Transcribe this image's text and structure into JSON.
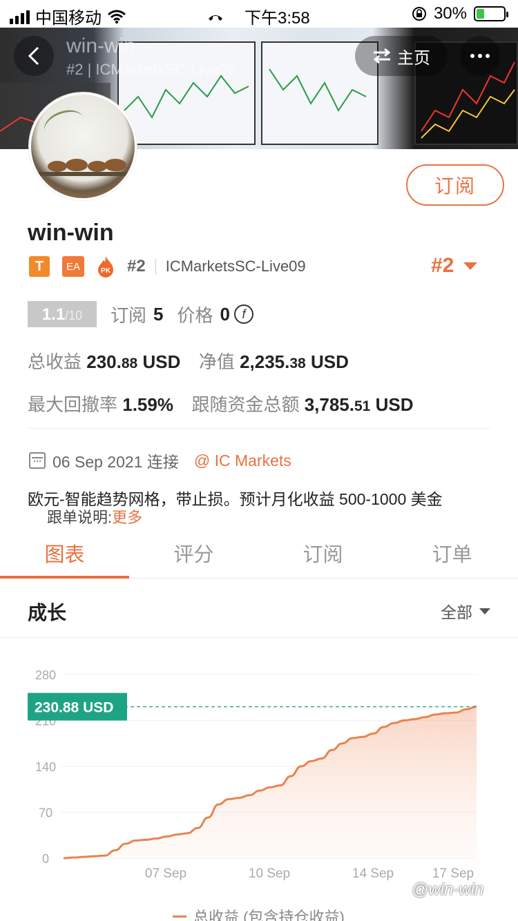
{
  "status_bar": {
    "carrier": "中国移动",
    "time": "下午3:58",
    "battery": "30%",
    "battery_level": 0.3
  },
  "banner": {
    "ghost_title": "win-win",
    "ghost_subtitle": "#2 | ICMarketsSC-Live09",
    "home_label": "主页",
    "icons": [
      "back-icon",
      "swap-icon",
      "more-icon"
    ]
  },
  "profile": {
    "subscribe_label": "订阅",
    "username": "win-win",
    "tag_t": "T",
    "tag_ea": "EA",
    "tag_pk": "PK",
    "rank": "#2",
    "server": "ICMarketsSC-Live09",
    "rank_big": "#2"
  },
  "stats": {
    "score": "1.1",
    "score_max": "/10",
    "subscribers_label": "订阅",
    "subscribers": "5",
    "price_label": "价格",
    "price": "0",
    "coin_symbol": "f",
    "total_profit_label": "总收益",
    "total_profit_int": "230.",
    "total_profit_dec": "88",
    "total_profit_unit": "USD",
    "equity_label": "净值",
    "equity_int": "2,235.",
    "equity_dec": "38",
    "equity_unit": "USD",
    "max_drawdown_label": "最大回撤率",
    "max_drawdown": "1.59%",
    "follow_funds_label": "跟随资金总额",
    "follow_funds_int": "3,785.",
    "follow_funds_dec": "51",
    "follow_funds_unit": "USD"
  },
  "connection": {
    "date": "06 Sep 2021 连接",
    "broker": "@ IC Markets"
  },
  "description": {
    "line1": "欧元-智能趋势网格，带止损。预计月化收益 500-1000 美金",
    "line2_prefix": "跟单说明:",
    "more": "更多"
  },
  "tabs": [
    "图表",
    "评分",
    "订阅",
    "订单"
  ],
  "active_tab": 0,
  "growth": {
    "title": "成长",
    "range": "全部"
  },
  "chart_data": {
    "type": "area",
    "y_ticks": [
      0,
      70,
      140,
      210,
      280
    ],
    "ylim": [
      0,
      280
    ],
    "x_ticks": [
      "07 Sep",
      "10 Sep",
      "14 Sep",
      "17 Sep"
    ],
    "current_value_label": "230.88 USD",
    "current_value": 230.88,
    "series": [
      {
        "name": "总收益 (包含持仓收益)",
        "color": "#e8844f",
        "points": [
          0,
          1,
          2,
          3,
          4,
          12,
          22,
          27,
          28,
          30,
          33,
          36,
          38,
          46,
          62,
          82,
          90,
          92,
          96,
          103,
          108,
          111,
          125,
          140,
          148,
          152,
          165,
          175,
          183,
          185,
          190,
          200,
          206,
          210,
          212,
          215,
          219,
          221,
          222,
          227,
          231
        ]
      }
    ]
  },
  "watermark": "@win-win"
}
